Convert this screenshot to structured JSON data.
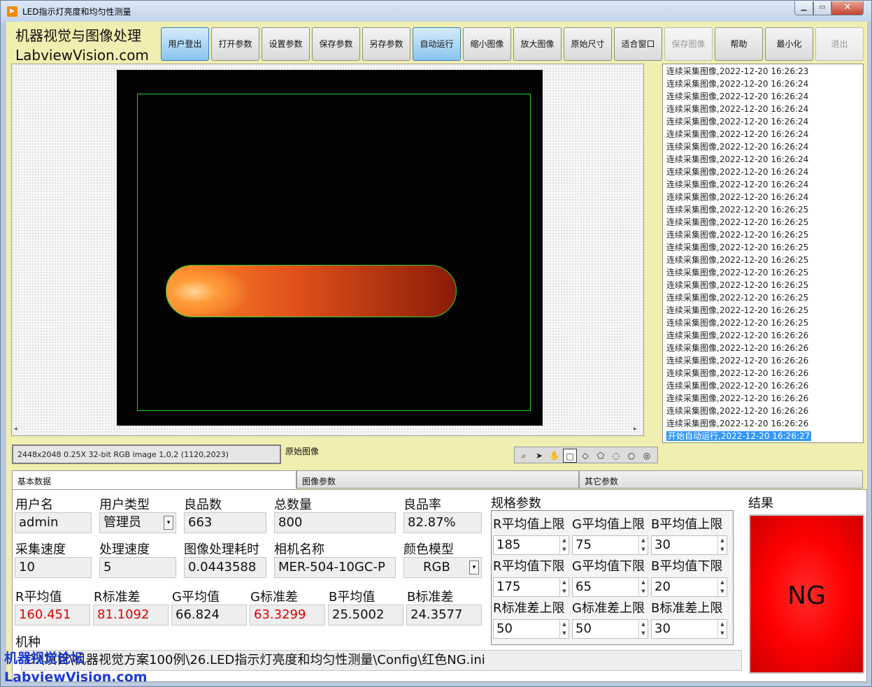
{
  "window": {
    "title": "LED指示灯亮度和均匀性测量",
    "icon": "play-icon",
    "controls": [
      "minimize-icon",
      "maximize-icon",
      "close-icon"
    ]
  },
  "brand": {
    "line1": "机器视觉与图像处理",
    "line2": "LabviewVision.com"
  },
  "toolbar": [
    {
      "label": "用户登出",
      "state": "active"
    },
    {
      "label": "打开参数",
      "state": "normal"
    },
    {
      "label": "设置参数",
      "state": "normal"
    },
    {
      "label": "保存参数",
      "state": "normal"
    },
    {
      "label": "另存参数",
      "state": "normal"
    },
    {
      "label": "自动运行",
      "state": "active"
    },
    {
      "label": "缩小图像",
      "state": "normal"
    },
    {
      "label": "放大图像",
      "state": "normal"
    },
    {
      "label": "原始尺寸",
      "state": "normal"
    },
    {
      "label": "适合窗口",
      "state": "normal"
    },
    {
      "label": "保存图像",
      "state": "disabled"
    },
    {
      "label": "帮助",
      "state": "normal"
    },
    {
      "label": "最小化",
      "state": "normal"
    },
    {
      "label": "退出",
      "state": "disabled"
    }
  ],
  "log": [
    "连续采集图像,2022-12-20 16:26:23",
    "连续采集图像,2022-12-20 16:26:24",
    "连续采集图像,2022-12-20 16:26:24",
    "连续采集图像,2022-12-20 16:26:24",
    "连续采集图像,2022-12-20 16:26:24",
    "连续采集图像,2022-12-20 16:26:24",
    "连续采集图像,2022-12-20 16:26:24",
    "连续采集图像,2022-12-20 16:26:24",
    "连续采集图像,2022-12-20 16:26:24",
    "连续采集图像,2022-12-20 16:26:24",
    "连续采集图像,2022-12-20 16:26:24",
    "连续采集图像,2022-12-20 16:26:25",
    "连续采集图像,2022-12-20 16:26:25",
    "连续采集图像,2022-12-20 16:26:25",
    "连续采集图像,2022-12-20 16:26:25",
    "连续采集图像,2022-12-20 16:26:25",
    "连续采集图像,2022-12-20 16:26:25",
    "连续采集图像,2022-12-20 16:26:25",
    "连续采集图像,2022-12-20 16:26:25",
    "连续采集图像,2022-12-20 16:26:25",
    "连续采集图像,2022-12-20 16:26:25",
    "连续采集图像,2022-12-20 16:26:26",
    "连续采集图像,2022-12-20 16:26:26",
    "连续采集图像,2022-12-20 16:26:26",
    "连续采集图像,2022-12-20 16:26:26",
    "连续采集图像,2022-12-20 16:26:26",
    "连续采集图像,2022-12-20 16:26:26",
    "连续采集图像,2022-12-20 16:26:26",
    "连续采集图像,2022-12-20 16:26:26",
    "开始自动运行,2022-12-20 16:26:27"
  ],
  "image_status": "2448x2048 0.25X 32-bit RGB image 1,0,2     (1120,2023)",
  "image_caption": "原始图像",
  "image_tools": [
    "zoom-icon",
    "pointer-icon",
    "pan-hand-icon",
    "rectangle-roi-icon",
    "rotated-rect-roi-icon",
    "polygon-roi-icon",
    "freehand-roi-icon",
    "circle-roi-icon",
    "annulus-roi-icon"
  ],
  "tabs": [
    "基本数据",
    "图像参数",
    "其它参数"
  ],
  "basic": {
    "username_label": "用户名",
    "username": "admin",
    "usertype_label": "用户类型",
    "usertype": "管理员",
    "good_label": "良品数",
    "good": "663",
    "total_label": "总数量",
    "total": "800",
    "yield_label": "良品率",
    "yield": "82.87%",
    "capture_speed_label": "采集速度",
    "capture_speed": "10",
    "proc_speed_label": "处理速度",
    "proc_speed": "5",
    "proc_time_label": "图像处理耗时",
    "proc_time": "0.0443588",
    "camera_label": "相机名称",
    "camera": "MER-504-10GC-P",
    "color_model_label": "颜色模型",
    "color_model": "RGB",
    "r_mean_label": "R平均值",
    "r_mean": "160.451",
    "r_std_label": "R标准差",
    "r_std": "81.1092",
    "g_mean_label": "G平均值",
    "g_mean": "66.824",
    "g_std_label": "G标准差",
    "g_std": "63.3299",
    "b_mean_label": "B平均值",
    "b_mean": "25.5002",
    "b_std_label": "B标准差",
    "b_std": "24.3577",
    "model_label": "机种",
    "model_path": "D:\\项目\\机器视觉方案100例\\26.LED指示灯亮度和均匀性测量\\Config\\红色NG.ini"
  },
  "spec": {
    "title": "规格参数",
    "rows": [
      {
        "labels": [
          "R平均值上限",
          "G平均值上限",
          "B平均值上限"
        ],
        "values": [
          "185",
          "75",
          "30"
        ]
      },
      {
        "labels": [
          "R平均值下限",
          "G平均值下限",
          "B平均值下限"
        ],
        "values": [
          "175",
          "65",
          "20"
        ]
      },
      {
        "labels": [
          "R标准差上限",
          "G标准差上限",
          "B标准差上限"
        ],
        "values": [
          "50",
          "50",
          "30"
        ]
      }
    ]
  },
  "result": {
    "label": "结果",
    "value": "NG",
    "color": "#ff0000"
  },
  "watermark": {
    "line1": "机器视觉论坛",
    "line2": "LabviewVision.com"
  }
}
